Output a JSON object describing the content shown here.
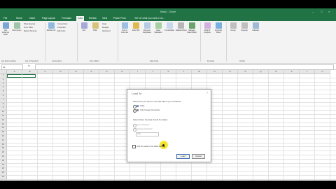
{
  "window": {
    "title": "Book1 - Excel"
  },
  "tabs": [
    "File",
    "Home",
    "Insert",
    "Page Layout",
    "Formulas",
    "Data",
    "Review",
    "View",
    "Power Pivot"
  ],
  "active_tab": "Data",
  "tell_me": "Tell me what you want to do...",
  "ribbon": {
    "buttons": [
      {
        "label": "Get External Data"
      },
      {
        "label": "New Query"
      },
      {
        "label": "Refresh All"
      },
      {
        "label": "Sort"
      },
      {
        "label": "Filter"
      },
      {
        "label": "Advanced"
      },
      {
        "label": "Text to Columns"
      },
      {
        "label": "Flash Fill"
      },
      {
        "label": "Remove Duplicates"
      },
      {
        "label": "Data Validation"
      },
      {
        "label": "Consolidate"
      },
      {
        "label": "Relationships"
      },
      {
        "label": "Manage Data Model"
      },
      {
        "label": "What-If Analysis"
      },
      {
        "label": "Forecast Sheet"
      },
      {
        "label": "Group"
      },
      {
        "label": "Ungroup"
      },
      {
        "label": "Subtotal"
      }
    ],
    "small": [
      "Show Queries",
      "From Table",
      "Recent Sources",
      "Connections",
      "Properties",
      "Edit Links",
      "Clear",
      "Reapply"
    ],
    "groups": [
      "Get External Data",
      "Get & Transform",
      "Connections",
      "Sort & Filter",
      "Data Tools",
      "Forecast",
      "Outline"
    ]
  },
  "formula_bar": {
    "name_box": "A1",
    "fx": "fx"
  },
  "columns": [
    "A",
    "B",
    "C",
    "D",
    "E",
    "F",
    "G",
    "H",
    "I",
    "J",
    "K",
    "L",
    "M",
    "N",
    "O",
    "P",
    "Q",
    "R",
    "S",
    "T",
    "U"
  ],
  "rows": [
    "1",
    "2",
    "3",
    "4",
    "5",
    "6",
    "7",
    "8",
    "9",
    "10",
    "11",
    "12",
    "13",
    "14",
    "15",
    "16",
    "17",
    "18",
    "19",
    "20",
    "21",
    "22",
    "23",
    "24",
    "25",
    "26"
  ],
  "dialog": {
    "title": "Load To",
    "close": "?",
    "prompt1": "Select how you want to view this data in your workbook.",
    "view_options": [
      "Table",
      "Only Create Connection"
    ],
    "prompt2": "Select where the data should be loaded.",
    "location_options": [
      "New worksheet",
      "Existing worksheet:"
    ],
    "existing_ref": "$A$1",
    "checkbox": "Add this data to the Data Model",
    "ok": "Load",
    "cancel": "Cancel"
  },
  "colors": {
    "excel_green": "#217346",
    "highlight": "#f5e51f"
  }
}
